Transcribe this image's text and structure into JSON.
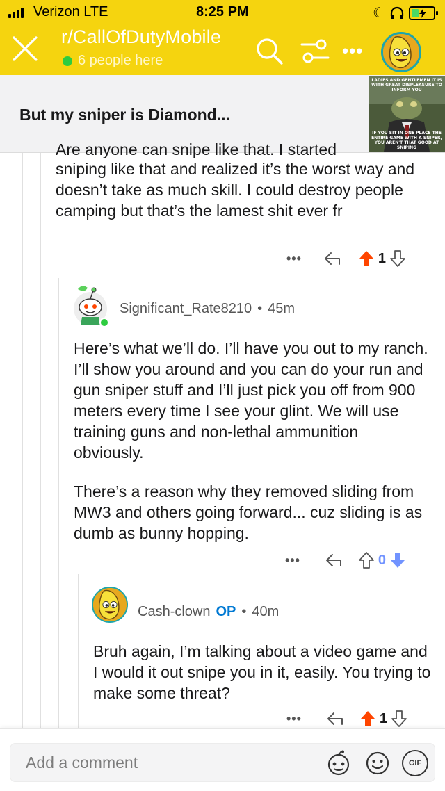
{
  "status_bar": {
    "carrier": "Verizon  LTE",
    "time": "8:25 PM"
  },
  "header": {
    "subreddit": "r/CallOfDutyMobile",
    "online_count": "6 people here",
    "more_label": "•••",
    "accent_color": "#f5d40f",
    "icons": [
      "close-icon",
      "search-icon",
      "filter-icon",
      "more-icon",
      "user-avatar"
    ]
  },
  "post": {
    "title": "But my sniper is Diamond...",
    "thumbnail_text": {
      "top": "Ladies and gentlemen it is with great displeasure to inform you",
      "bottom": "If you sit in one place the entire game with a sniper, you aren't that good at sniping"
    }
  },
  "comments": [
    {
      "id": "parent",
      "partial_first_line": "Are anyone can snipe like that. I started",
      "body": "sniping like that and realized it’s the worst way and doesn’t take as much skill. I could destroy people camping but that’s the lamest shit ever fr",
      "votes": "1",
      "vote_state": "up"
    },
    {
      "id": "reply1",
      "author": "Significant_Rate8210",
      "age": "45m",
      "paragraphs": [
        "Here’s what we’ll do. I’ll have you out to my ranch. I’ll show you around and you can do your run and gun sniper stuff and I’ll just pick you off from 900 meters every time I see your glint. We will use training guns and non-lethal ammunition obviously.",
        "There’s a reason why they removed sliding from MW3 and others going forward... cuz sliding is as dumb as bunny hopping."
      ],
      "votes": "0",
      "vote_state": "down"
    },
    {
      "id": "reply2",
      "author": "Cash-clown",
      "op_tag": "OP",
      "age": "40m",
      "body": "Bruh again, I’m talking about a video game and I would it out snipe you in it, easily. You trying to make some threat?",
      "votes": "1",
      "vote_state": "up"
    }
  ],
  "common": {
    "more_label": "•••",
    "dot_sep": "•"
  },
  "composer": {
    "placeholder": "Add a comment",
    "gif_label": "GIF"
  },
  "colors": {
    "upvote": "#ff4500",
    "downvote": "#7193ff",
    "op": "#0079d3",
    "online": "#2ecc40"
  }
}
